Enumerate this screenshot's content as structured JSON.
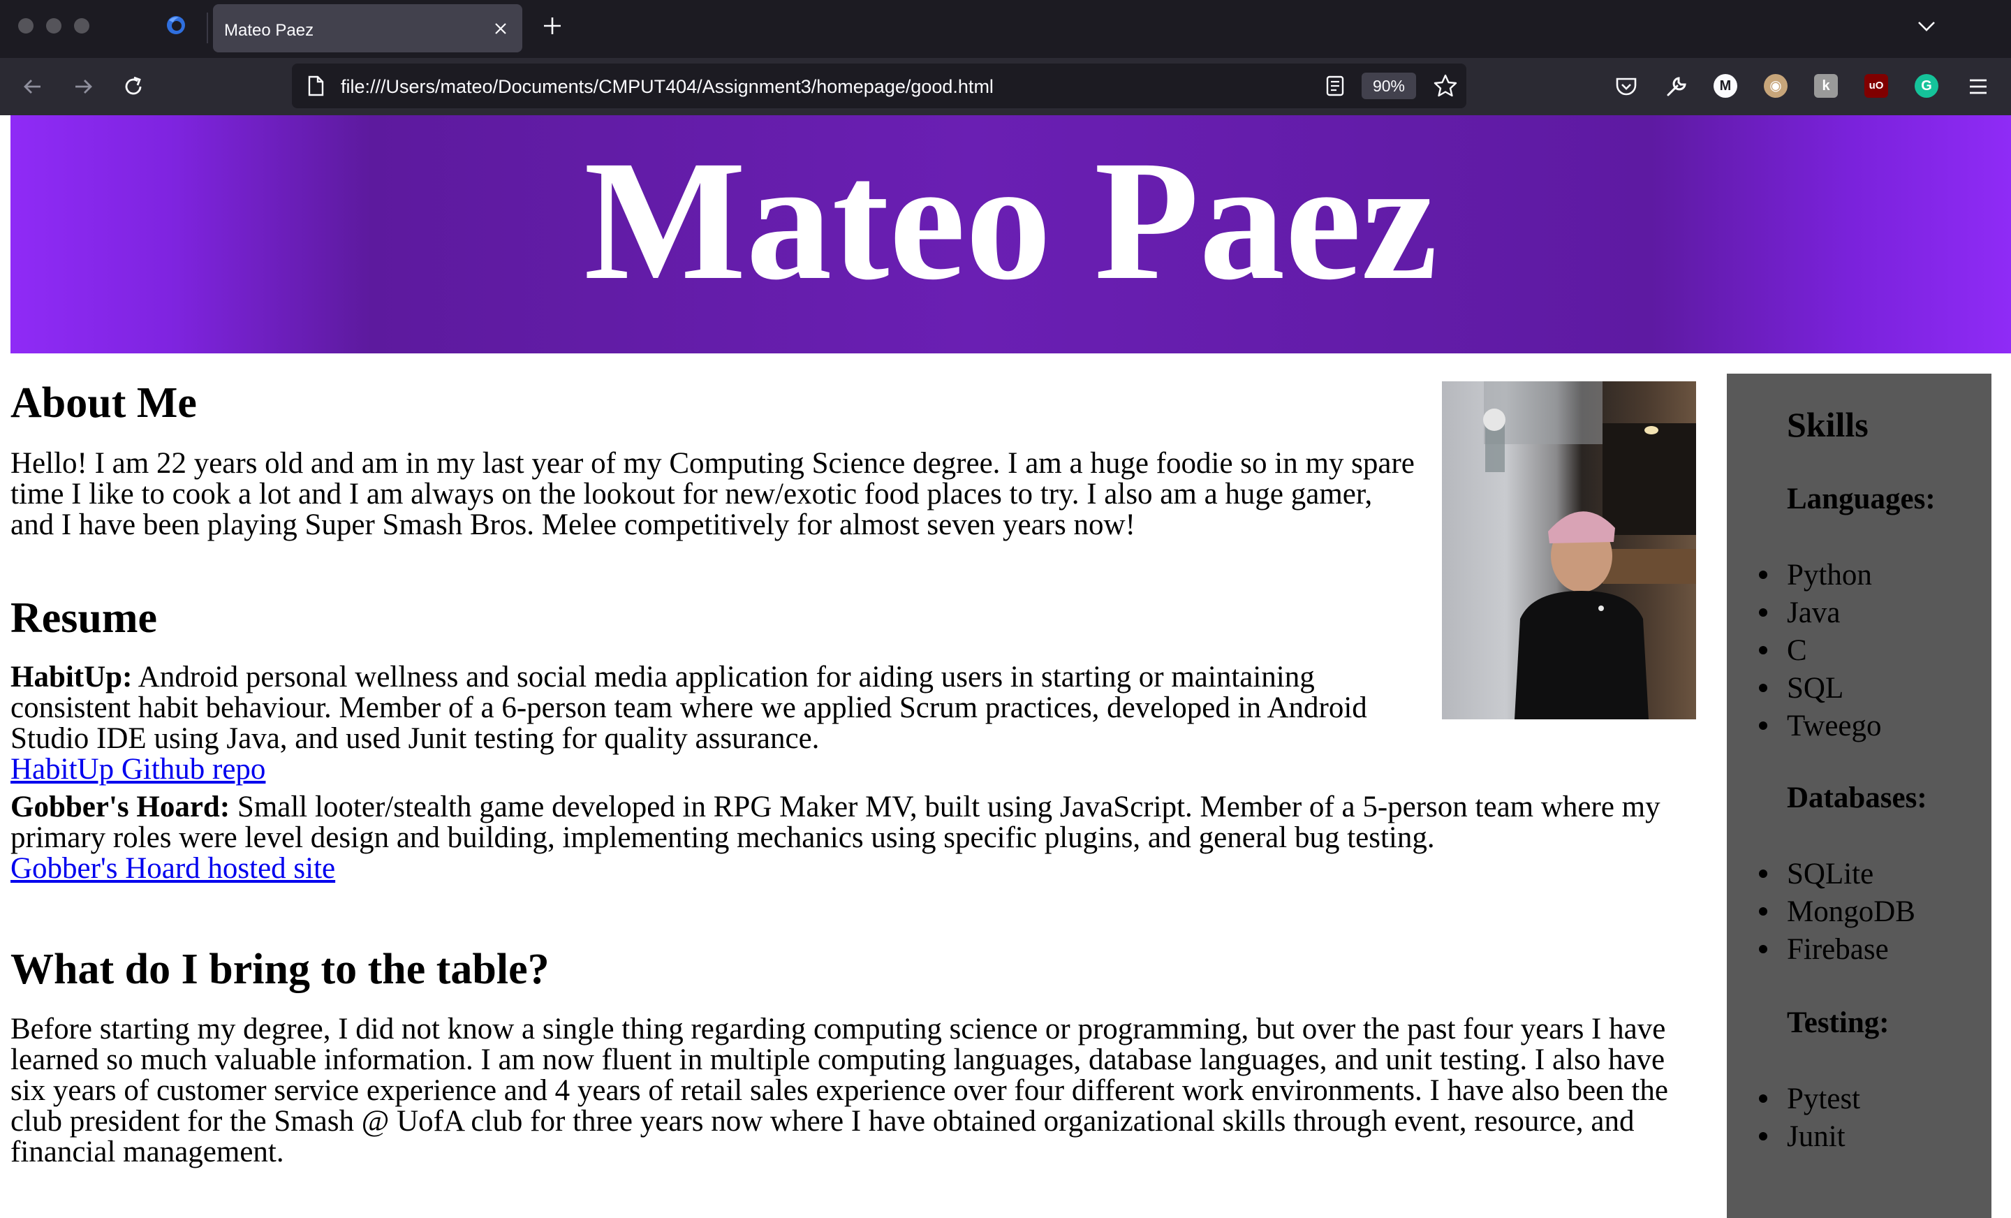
{
  "browser": {
    "tab_title": "Mateo Paez",
    "url": "file:///Users/mateo/Documents/CMPUT404/Assignment3/homepage/good.html",
    "zoom": "90%"
  },
  "header": {
    "name": "Mateo Paez",
    "colors": {
      "gradient_edge": "#8f2bf6",
      "gradient_center": "#5d1a9e"
    }
  },
  "about": {
    "heading": "About Me",
    "text_lines": [
      "Hello! I am 22 years old and am in my last year of my Computing Science degree. I am a huge foodie so in my spare",
      "time I like to cook a lot and I am always on the lookout for new/exotic food places to try. I also am a huge gamer,",
      "and I have been playing Super Smash Bros. Melee competitively for almost seven years now!"
    ]
  },
  "resume": {
    "heading": "Resume",
    "projects": [
      {
        "name": "HabitUp:",
        "lines": [
          " Android personal wellness and social media application for aiding users in starting or maintaining",
          "consistent habit behaviour. Member of a 6-person team where we applied Scrum practices, developed in Android",
          "Studio IDE using Java, and used Junit testing for quality assurance."
        ],
        "link_text": "HabitUp Github repo"
      },
      {
        "name": "Gobber's Hoard:",
        "lines": [
          " Small looter/stealth game developed in RPG Maker MV, built using JavaScript. Member of a 5-person team where my",
          "primary roles were level design and building, implementing mechanics using specific plugins, and general bug testing."
        ],
        "link_text": "Gobber's Hoard hosted site"
      }
    ]
  },
  "bring": {
    "heading": "What do I bring to the table?",
    "text_lines": [
      "Before starting my degree, I did not know a single thing regarding computing science or programming, but over the past four years I have",
      "learned so much valuable information. I am now fluent in multiple computing languages, database languages, and unit testing. I also have",
      "six years of customer service experience and 4 years of retail sales experience over four different work environments. I have also been the",
      "club president for the Smash @ UofA club for three years now where I have obtained organizational skills through event, resource, and",
      "financial management."
    ]
  },
  "skills": {
    "heading": "Skills",
    "languages_heading": "Languages:",
    "languages": [
      "Python",
      "Java",
      "C",
      "SQL",
      "Tweego"
    ],
    "databases_heading": "Databases:",
    "databases": [
      "SQLite",
      "MongoDB",
      "Firebase"
    ],
    "testing_heading": "Testing:",
    "testing": [
      "Pytest",
      "Junit"
    ],
    "sidebar_color": "#595959"
  },
  "profile_photo": {
    "icon": "person-photo"
  }
}
